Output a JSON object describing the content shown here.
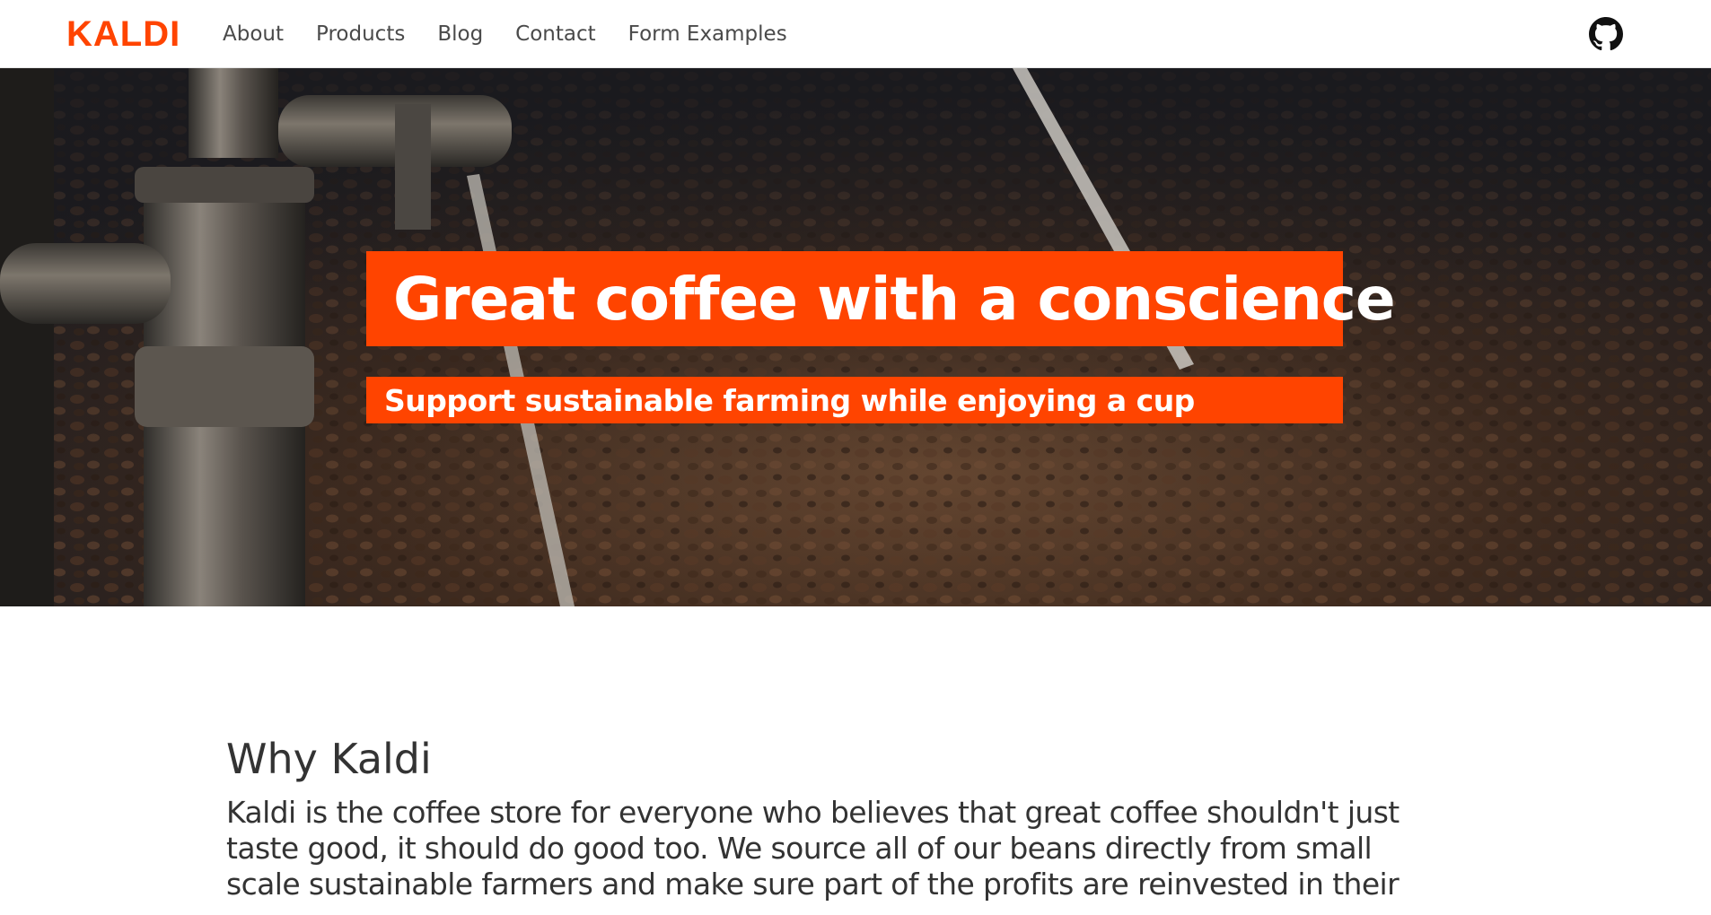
{
  "brand": {
    "name": "KALDI",
    "accent_color": "#ff4400"
  },
  "nav": {
    "links": [
      {
        "label": "About"
      },
      {
        "label": "Products"
      },
      {
        "label": "Blog"
      },
      {
        "label": "Contact"
      },
      {
        "label": "Form Examples"
      }
    ],
    "github_icon": "github-icon"
  },
  "hero": {
    "title": "Great coffee with a conscience",
    "subtitle": "Support sustainable farming while enjoying a cup",
    "box_color": "#ff4400",
    "background": "coffee-roaster-image"
  },
  "why": {
    "heading": "Why Kaldi",
    "text": "Kaldi is the coffee store for everyone who believes that great coffee shouldn't just taste good, it should do good too. We source all of our beans directly from small scale sustainable farmers and make sure part of the profits are reinvested in their"
  }
}
